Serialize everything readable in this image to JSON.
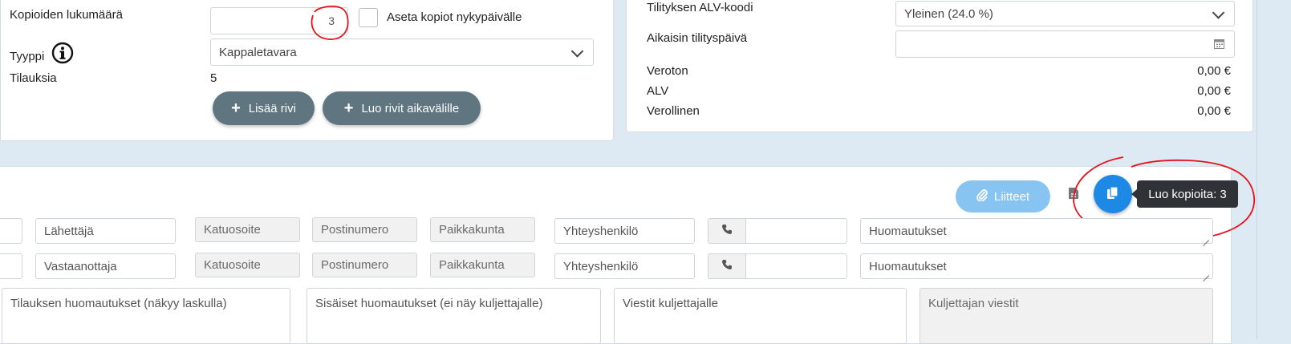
{
  "top_left": {
    "copies_label": "Kopioiden lukumäärä",
    "copies_value": "3",
    "set_copies_today_label": "Aseta kopiot nykypäivälle",
    "type_label": "Tyyppi",
    "type_value": "Kappaletavara",
    "orders_label": "Tilauksia",
    "orders_value": "5",
    "add_row_label": "Lisää rivi",
    "create_rows_label": "Luo rivit aikavälille"
  },
  "top_right": {
    "vat_code_label": "Tilityksen ALV-koodi",
    "vat_code_value": "Yleinen (24.0 %)",
    "earliest_date_label": "Aikaisin tilityspäivä",
    "taxfree_label": "Veroton",
    "taxfree_value": "0,00 €",
    "vat_label": "ALV",
    "vat_value": "0,00 €",
    "taxed_label": "Verollinen",
    "taxed_value": "0,00 €"
  },
  "toolbar": {
    "attachments_label": "Liitteet",
    "tooltip": "Luo kopioita: 3"
  },
  "rows": [
    {
      "party": "Lähettäjä",
      "street": "Katuosoite",
      "postal": "Postinumero",
      "city": "Paikkakunta",
      "contact": "Yhteyshenkilö",
      "notes": "Huomautukset"
    },
    {
      "party": "Vastaanottaja",
      "street": "Katuosoite",
      "postal": "Postinumero",
      "city": "Paikkakunta",
      "contact": "Yhteyshenkilö",
      "notes": "Huomautukset"
    }
  ],
  "bottom_notes": {
    "order_notes": "Tilauksen huomautukset (näkyy laskulla)",
    "internal_notes": "Sisäiset huomautukset (ei näy kuljettajalle)",
    "driver_messages": "Viestit kuljettajalle",
    "drivers_messages": "Kuljettajan viestit"
  },
  "colors": {
    "primary": "#1e88e5",
    "attachments": "#87c4f2",
    "dark_button": "#5f7680",
    "annotation": "#e8101a"
  }
}
